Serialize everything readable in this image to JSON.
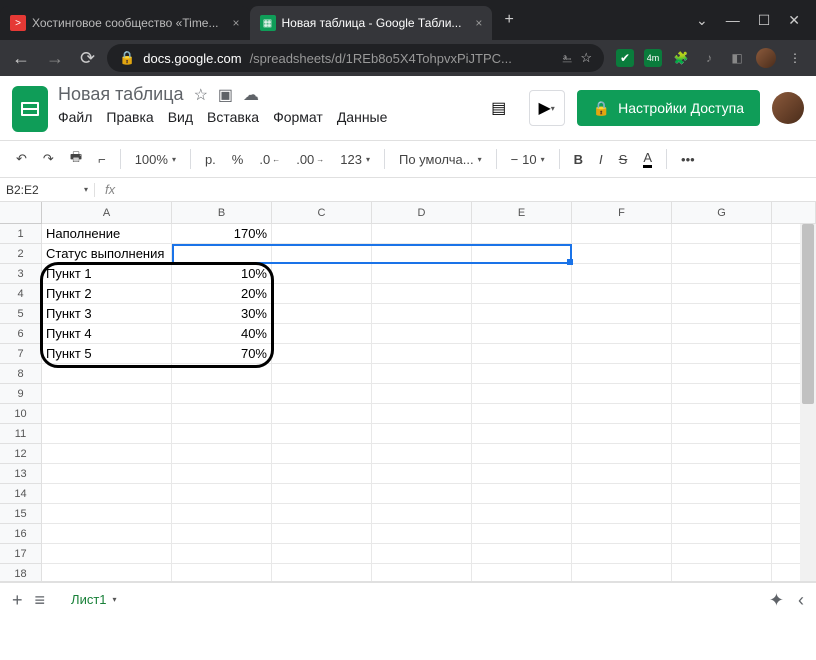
{
  "browser": {
    "tabs": [
      {
        "title": "Хостинговое сообщество «Time...",
        "icon_bg": "#e53935",
        "icon_char": ">"
      },
      {
        "title": "Новая таблица - Google Табли...",
        "icon_bg": "#0f9d58",
        "icon_char": ""
      }
    ],
    "url_host": "docs.google.com",
    "url_path": "/spreadsheets/d/1REb8o5X4TohpvxPiJTPC...",
    "ext_badge": "4m"
  },
  "doc": {
    "title": "Новая таблица",
    "menus": [
      "Файл",
      "Правка",
      "Вид",
      "Вставка",
      "Формат",
      "Данные"
    ],
    "share_label": "Настройки Доступа"
  },
  "toolbar": {
    "zoom": "100%",
    "currency": "р.",
    "percent": "%",
    "dec_less": ".0",
    "dec_more": ".00",
    "num_format": "123",
    "font": "По умолча...",
    "font_size": "10"
  },
  "namebox": "B2:E2",
  "columns": [
    "A",
    "B",
    "C",
    "D",
    "E",
    "F",
    "G",
    ""
  ],
  "row_count": 18,
  "cells": {
    "A1": "Наполнение",
    "B1": "170%",
    "A2": "Статус выполнения",
    "A3": "Пункт 1",
    "B3": "10%",
    "A4": "Пункт 2",
    "B4": "20%",
    "A5": "Пункт 3",
    "B5": "30%",
    "A6": "Пункт 4",
    "B6": "40%",
    "A7": "Пункт 5",
    "B7": "70%"
  },
  "sheet_tab": "Лист1"
}
